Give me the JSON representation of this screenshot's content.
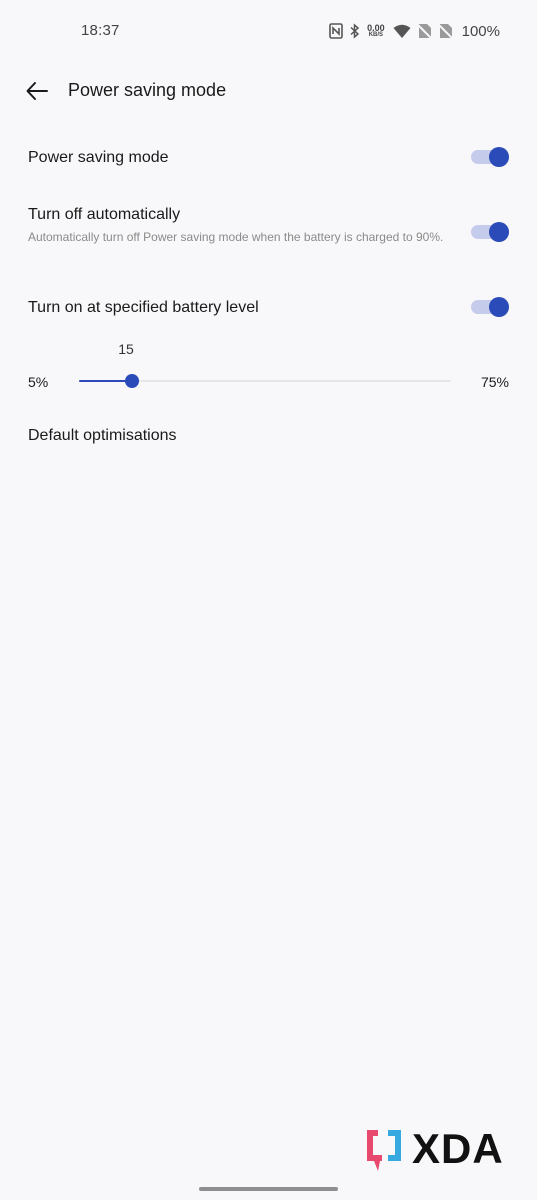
{
  "status_bar": {
    "time": "18:37",
    "net_speed_value": "0.00",
    "net_speed_unit": "KB/S",
    "battery": "100%",
    "icons": [
      "nfc-icon",
      "bluetooth-icon",
      "wifi-icon",
      "no-sim-icon",
      "no-sim-icon"
    ]
  },
  "header": {
    "title": "Power saving mode",
    "back_icon": "arrow-left-icon"
  },
  "settings": {
    "power_saving": {
      "title": "Power saving mode",
      "enabled": true
    },
    "turn_off_auto": {
      "title": "Turn off automatically",
      "description": "Automatically turn off Power saving mode when the battery is charged to 90%.",
      "enabled": true
    },
    "turn_on_level": {
      "title": "Turn on at specified battery level",
      "enabled": true
    },
    "battery_level_slider": {
      "value": 15,
      "value_label": "15",
      "min": 5,
      "max": 75,
      "min_label": "5%",
      "max_label": "75%"
    },
    "default_optimisations": {
      "title": "Default optimisations"
    }
  },
  "watermark": {
    "text": "XDA"
  },
  "colors": {
    "accent": "#2a4bb8",
    "toggle_track": "#c5cbea",
    "background": "#f8f8fa",
    "watermark_pink": "#e84a6f",
    "watermark_blue": "#36a9e1"
  }
}
